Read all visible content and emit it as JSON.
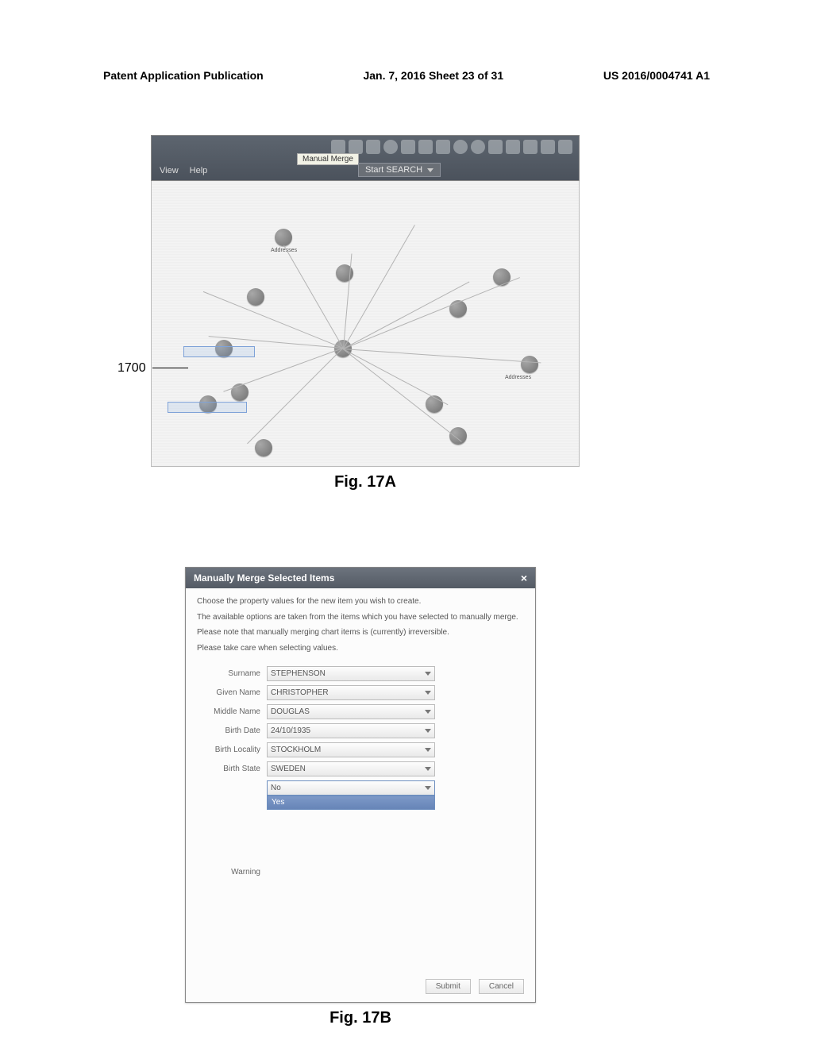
{
  "header": {
    "left": "Patent Application Publication",
    "middle": "Jan. 7, 2016   Sheet 23 of 31",
    "right": "US 2016/0004741 A1"
  },
  "fig17a": {
    "caption": "Fig. 17A",
    "toolbar": {
      "menu_view": "View",
      "menu_help": "Help",
      "tooltip": "Manual Merge",
      "start_search": "Start SEARCH"
    },
    "ref_1700": "1700",
    "nodes": {
      "addresses1": "Addresses",
      "addresses2": "Addresses"
    }
  },
  "fig17b": {
    "caption": "Fig. 17B",
    "dialog": {
      "title": "Manually Merge Selected Items",
      "close": "×",
      "instr1": "Choose the property values for the new item you wish to create.",
      "instr2": "The available options are taken from the items which you have selected to manually merge.",
      "instr3": "Please note that manually merging chart items is (currently) irreversible.",
      "instr4": "Please take care when selecting values.",
      "fields": [
        {
          "label": "Surname",
          "value": "STEPHENSON"
        },
        {
          "label": "Given Name",
          "value": "CHRISTOPHER"
        },
        {
          "label": "Middle Name",
          "value": "DOUGLAS"
        },
        {
          "label": "Birth Date",
          "value": "24/10/1935"
        },
        {
          "label": "Birth Locality",
          "value": "STOCKHOLM"
        },
        {
          "label": "Birth State",
          "value": "SWEDEN"
        }
      ],
      "warning_label": "Warning",
      "warning_value": "No",
      "dropdown_option": "Yes",
      "submit": "Submit",
      "cancel": "Cancel"
    }
  }
}
